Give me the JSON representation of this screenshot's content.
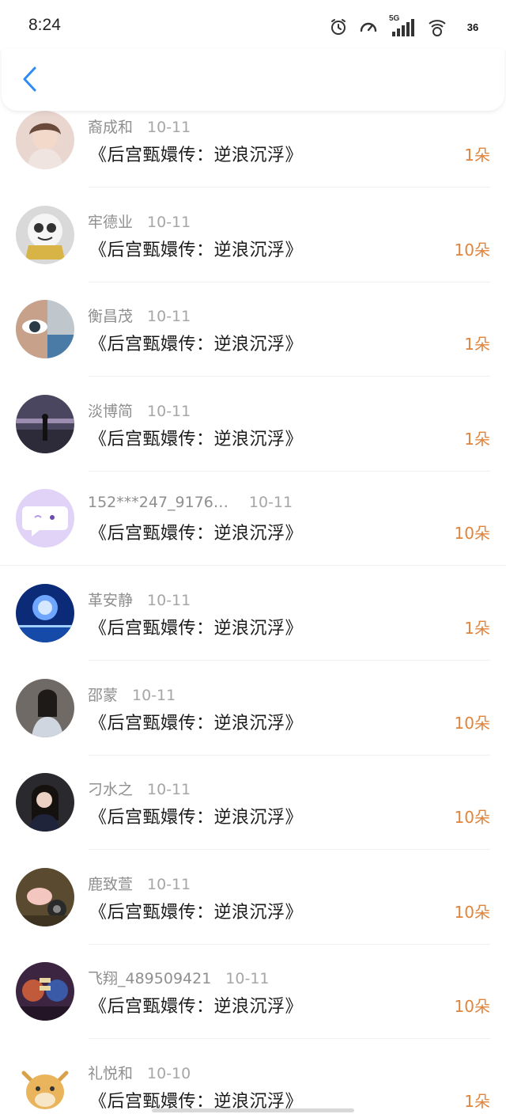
{
  "status_bar": {
    "time": "8:24",
    "network_label": "5G",
    "battery": "36"
  },
  "colors": {
    "accent_blue": "#2f8cf2",
    "amount_orange": "#e0843c"
  },
  "nav": {
    "back_icon": "chevron-left-icon"
  },
  "items": [
    {
      "user": "裔成和",
      "date": "10-11",
      "title": "《后宫甄嬛传：逆浪沉浮》",
      "amount": "1朵"
    },
    {
      "user": "牢德业",
      "date": "10-11",
      "title": "《后宫甄嬛传：逆浪沉浮》",
      "amount": "10朵"
    },
    {
      "user": "衡昌茂",
      "date": "10-11",
      "title": "《后宫甄嬛传：逆浪沉浮》",
      "amount": "1朵"
    },
    {
      "user": "淡博简",
      "date": "10-11",
      "title": "《后宫甄嬛传：逆浪沉浮》",
      "amount": "1朵"
    },
    {
      "user": "152***247_9176…",
      "date": "10-11",
      "title": "《后宫甄嬛传：逆浪沉浮》",
      "amount": "10朵"
    },
    {
      "user": "革安静",
      "date": "10-11",
      "title": "《后宫甄嬛传：逆浪沉浮》",
      "amount": "1朵"
    },
    {
      "user": "邵蒙",
      "date": "10-11",
      "title": "《后宫甄嬛传：逆浪沉浮》",
      "amount": "10朵"
    },
    {
      "user": "刁水之",
      "date": "10-11",
      "title": "《后宫甄嬛传：逆浪沉浮》",
      "amount": "10朵"
    },
    {
      "user": "鹿致萱",
      "date": "10-11",
      "title": "《后宫甄嬛传：逆浪沉浮》",
      "amount": "10朵"
    },
    {
      "user": "飞翔_489509421",
      "date": "10-11",
      "title": "《后宫甄嬛传：逆浪沉浮》",
      "amount": "10朵"
    },
    {
      "user": "礼悦和",
      "date": "10-10",
      "title": "《后宫甄嬛传：逆浪沉浮》",
      "amount": "1朵"
    }
  ]
}
